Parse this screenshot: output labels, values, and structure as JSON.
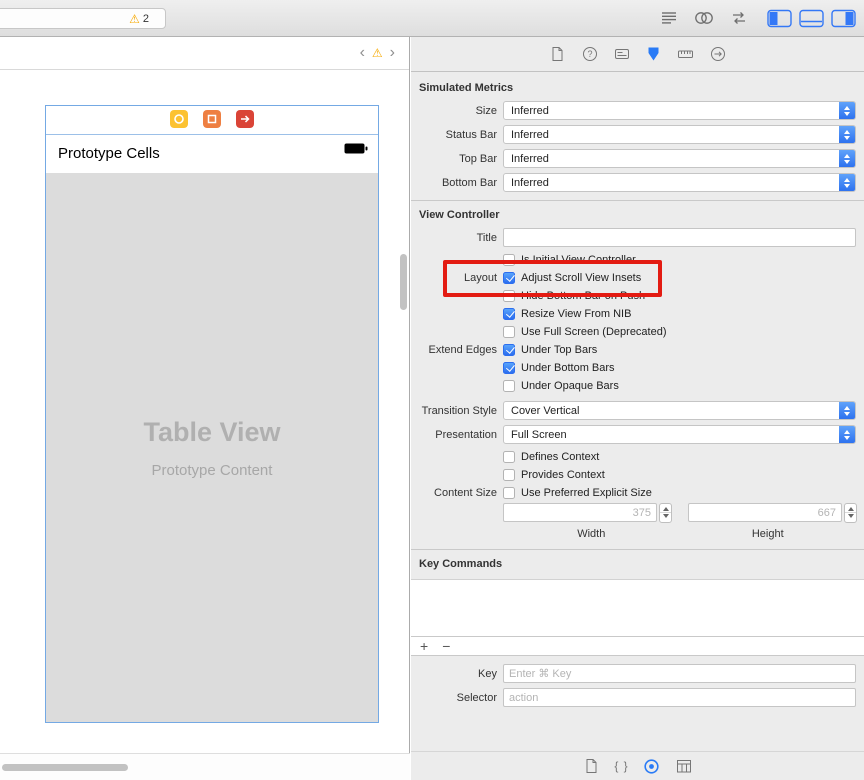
{
  "toolbar": {
    "warning_icon": "⚠",
    "warning_count": "2"
  },
  "jump_bar": {
    "back": "‹",
    "warning_icon": "⚠",
    "forward": "›"
  },
  "canvas": {
    "header_title": "Prototype Cells",
    "placeholder_title": "Table View",
    "placeholder_subtitle": "Prototype Content"
  },
  "inspector": {
    "simulated_metrics": {
      "title": "Simulated Metrics",
      "rows": [
        {
          "label": "Size",
          "value": "Inferred"
        },
        {
          "label": "Status Bar",
          "value": "Inferred"
        },
        {
          "label": "Top Bar",
          "value": "Inferred"
        },
        {
          "label": "Bottom Bar",
          "value": "Inferred"
        }
      ]
    },
    "view_controller": {
      "title": "View Controller",
      "title_row": {
        "label": "Title",
        "value": ""
      },
      "checks": [
        {
          "label": "",
          "text": "Is Initial View Controller",
          "checked": false
        },
        {
          "label": "Layout",
          "text": "Adjust Scroll View Insets",
          "checked": true
        },
        {
          "label": "",
          "text": "Hide Bottom Bar on Push",
          "checked": false
        },
        {
          "label": "",
          "text": "Resize View From NIB",
          "checked": true
        },
        {
          "label": "",
          "text": "Use Full Screen (Deprecated)",
          "checked": false
        },
        {
          "label": "Extend Edges",
          "text": "Under Top Bars",
          "checked": true
        },
        {
          "label": "",
          "text": "Under Bottom Bars",
          "checked": true
        },
        {
          "label": "",
          "text": "Under Opaque Bars",
          "checked": false
        }
      ],
      "popups": [
        {
          "label": "Transition Style",
          "value": "Cover Vertical"
        },
        {
          "label": "Presentation",
          "value": "Full Screen"
        }
      ],
      "context_checks": [
        {
          "label": "",
          "text": "Defines Context",
          "checked": false
        },
        {
          "label": "",
          "text": "Provides Context",
          "checked": false
        },
        {
          "label": "Content Size",
          "text": "Use Preferred Explicit Size",
          "checked": false
        }
      ],
      "size_fields": {
        "width_placeholder": "375",
        "height_placeholder": "667",
        "width_label": "Width",
        "height_label": "Height"
      }
    },
    "key_commands": {
      "title": "Key Commands",
      "add_button": "+",
      "remove_button": "−",
      "key_row": {
        "label": "Key",
        "placeholder": "Enter ⌘ Key"
      },
      "selector_row": {
        "label": "Selector",
        "placeholder": "action"
      },
      "braces_icon": "{ }"
    }
  }
}
